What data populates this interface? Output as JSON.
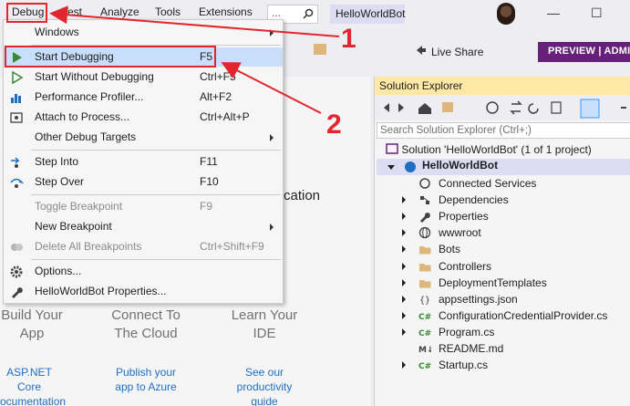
{
  "menubar": {
    "items": [
      "Debug",
      "Test",
      "Analyze",
      "Tools",
      "Extensions"
    ],
    "search_text": "...",
    "app_title": "HelloWorldBot",
    "window_buttons": [
      "—",
      "☐"
    ]
  },
  "toolbar": {
    "live_share": "Live Share",
    "preview": "PREVIEW | ADMI"
  },
  "debug_menu": {
    "items": [
      {
        "label": "Windows",
        "shortcut": "",
        "submenu": true
      },
      {
        "label": "Start Debugging",
        "shortcut": "F5"
      },
      {
        "label": "Start Without Debugging",
        "shortcut": "Ctrl+F5"
      },
      {
        "label": "Performance Profiler...",
        "shortcut": "Alt+F2"
      },
      {
        "label": "Attach to Process...",
        "shortcut": "Ctrl+Alt+P"
      },
      {
        "label": "Other Debug Targets",
        "shortcut": "",
        "submenu": true
      },
      {
        "label": "Step Into",
        "shortcut": "F11"
      },
      {
        "label": "Step Over",
        "shortcut": "F10"
      },
      {
        "label": "Toggle Breakpoint",
        "shortcut": "F9",
        "disabled": true
      },
      {
        "label": "New Breakpoint",
        "shortcut": "",
        "submenu": true
      },
      {
        "label": "Delete All Breakpoints",
        "shortcut": "Ctrl+Shift+F9",
        "disabled": true
      },
      {
        "label": "Options...",
        "shortcut": ""
      },
      {
        "label": "HelloWorldBot Properties...",
        "shortcut": ""
      }
    ]
  },
  "annotations": {
    "step1": "1",
    "step2": "2"
  },
  "start_page": {
    "fragment": "cation",
    "cols": [
      {
        "title_line1": "Build Your",
        "title_line2": "App",
        "link_line1": "ASP.NET",
        "link_line2": "Core",
        "link_line3": "ocumentation"
      },
      {
        "title_line1": "Connect To",
        "title_line2": "The Cloud",
        "link_line1": "Publish your",
        "link_line2": "app to Azure",
        "link_line3": ""
      },
      {
        "title_line1": "Learn Your",
        "title_line2": "IDE",
        "link_line1": "See our",
        "link_line2": "productivity",
        "link_line3": "guide"
      }
    ]
  },
  "solution_explorer": {
    "title": "Solution Explorer",
    "search_placeholder": "Search Solution Explorer (Ctrl+;)",
    "solution": "Solution 'HelloWorldBot' (1 of 1 project)",
    "project": "HelloWorldBot",
    "items": [
      {
        "label": "Connected Services",
        "icon": "connected-services-icon",
        "expandable": false
      },
      {
        "label": "Dependencies",
        "icon": "dependencies-icon",
        "expandable": true
      },
      {
        "label": "Properties",
        "icon": "wrench-icon",
        "expandable": true
      },
      {
        "label": "wwwroot",
        "icon": "globe-icon",
        "expandable": true
      },
      {
        "label": "Bots",
        "icon": "folder-icon",
        "expandable": true
      },
      {
        "label": "Controllers",
        "icon": "folder-icon",
        "expandable": true
      },
      {
        "label": "DeploymentTemplates",
        "icon": "folder-icon",
        "expandable": true
      },
      {
        "label": "appsettings.json",
        "icon": "json-file-icon",
        "expandable": true
      },
      {
        "label": "ConfigurationCredentialProvider.cs",
        "icon": "csharp-file-icon",
        "expandable": true
      },
      {
        "label": "Program.cs",
        "icon": "csharp-file-icon",
        "expandable": true
      },
      {
        "label": "README.md",
        "icon": "markdown-file-icon",
        "expandable": false
      },
      {
        "label": "Startup.cs",
        "icon": "csharp-file-icon",
        "expandable": true
      }
    ]
  },
  "colors": {
    "accent": "#68217a",
    "annotation": "#e3262e",
    "highlight": "#c9defa",
    "se_header": "#ffe8a6"
  }
}
